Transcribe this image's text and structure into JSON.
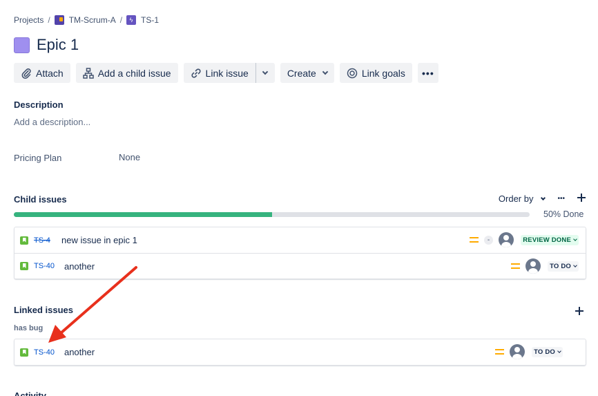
{
  "breadcrumb": {
    "projects": "Projects",
    "project": "TM-Scrum-A",
    "issue": "TS-1",
    "sep": "/"
  },
  "title": "Epic 1",
  "toolbar": {
    "attach": "Attach",
    "add_child": "Add a child issue",
    "link_issue": "Link issue",
    "create": "Create",
    "link_goals": "Link goals",
    "more": "•••"
  },
  "description": {
    "label": "Description",
    "placeholder": "Add a description..."
  },
  "fields": {
    "pricing_plan_label": "Pricing Plan",
    "pricing_plan_value": "None"
  },
  "child_issues": {
    "label": "Child issues",
    "order_by": "Order by",
    "more": "•••",
    "progress_done": 0.5,
    "progress_text": "50% Done",
    "items": [
      {
        "key": "TS-4",
        "summary": "new issue in epic 1",
        "estimate": "-",
        "status": "REVIEW DONE",
        "resolved": true
      },
      {
        "key": "TS-40",
        "summary": "another",
        "status": "TO DO",
        "resolved": false
      }
    ]
  },
  "linked_issues": {
    "label": "Linked issues",
    "relation": "has bug",
    "items": [
      {
        "key": "TS-40",
        "summary": "another",
        "status": "TO DO"
      }
    ]
  },
  "activity": {
    "label": "Activity"
  },
  "colors": {
    "progress": "#36b37e",
    "annotation_arrow": "#e8301c",
    "epic": "#9f8fef",
    "link": "#0052cc"
  },
  "icons": [
    "paperclip-icon",
    "hierarchy-icon",
    "link-icon",
    "target-icon",
    "story-icon",
    "priority-medium-icon",
    "avatar-icon",
    "plus-icon"
  ]
}
